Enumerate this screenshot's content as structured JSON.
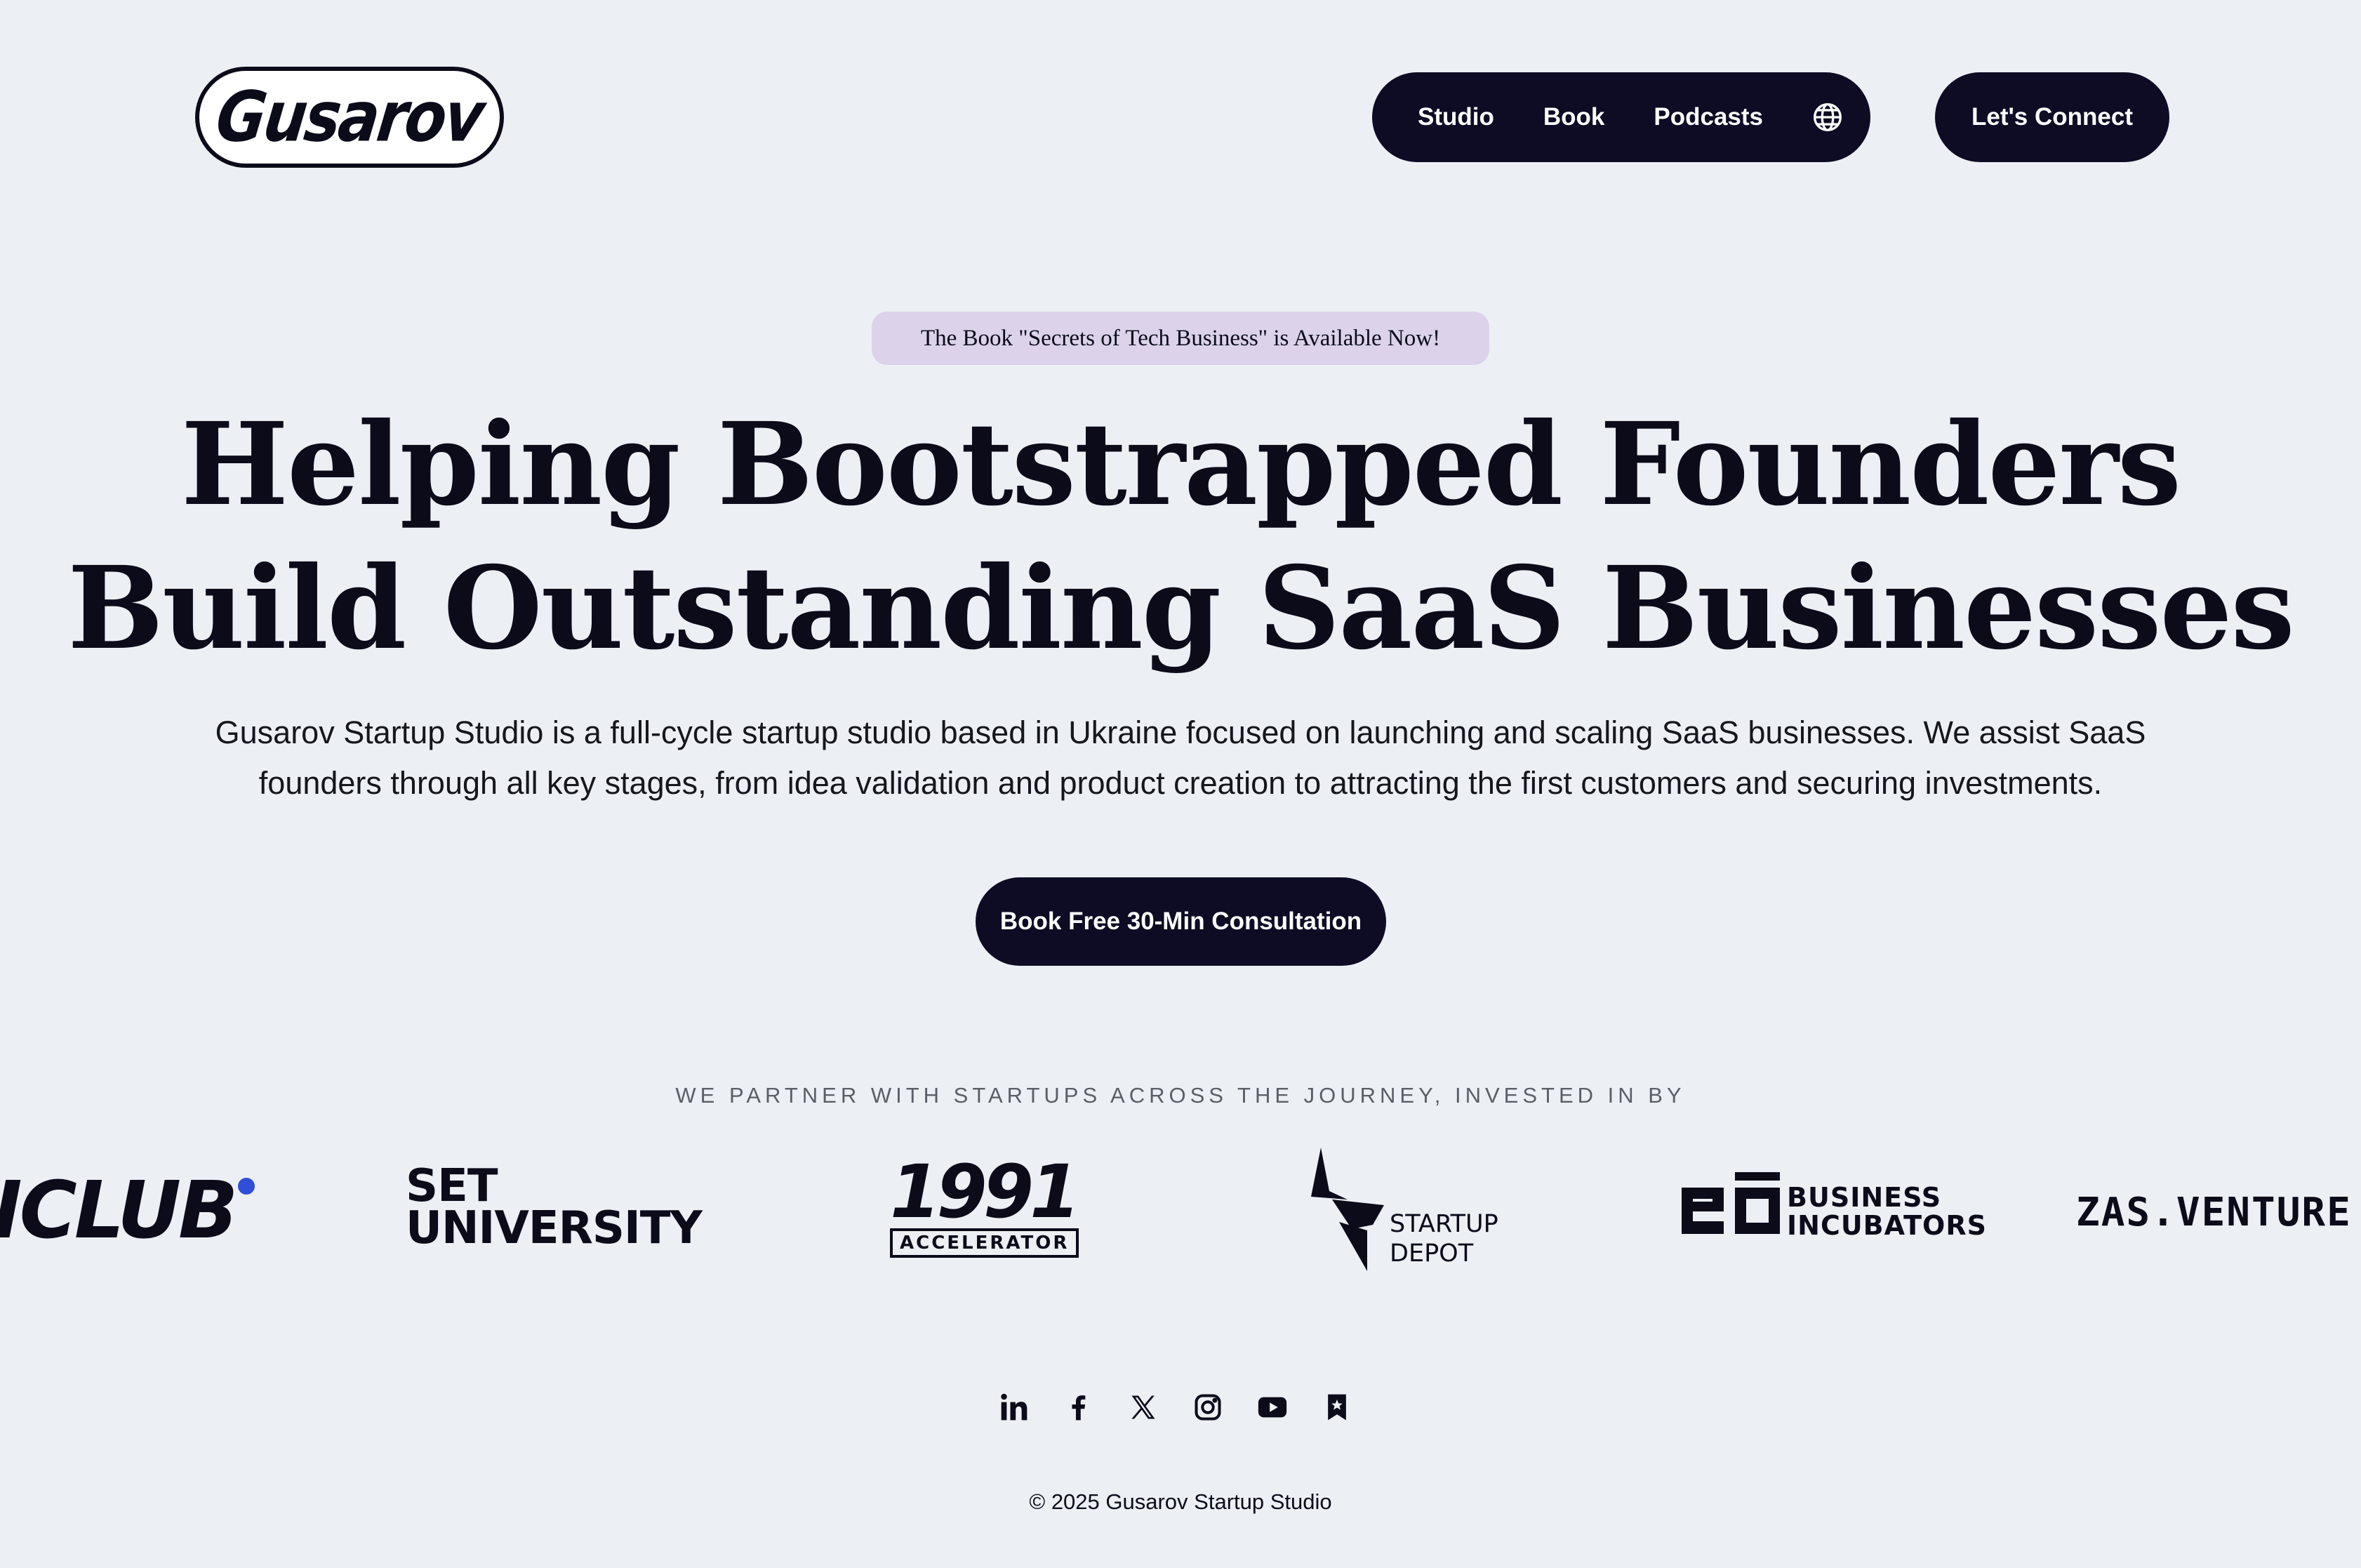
{
  "header": {
    "logo_text": "Gusarov",
    "nav": [
      {
        "label": "Studio"
      },
      {
        "label": "Book"
      },
      {
        "label": "Podcasts"
      }
    ],
    "language_icon": "globe-icon",
    "connect_label": "Let's Connect"
  },
  "hero": {
    "badge": "The Book \"Secrets of Tech Business\" is Available Now!",
    "headline_line1": "Helping Bootstrapped Founders",
    "headline_line2": "Build Outstanding SaaS Businesses",
    "description": "Gusarov Startup Studio is a full-cycle startup studio based in Ukraine focused on launching and scaling SaaS businesses. We assist SaaS founders through all key stages, from idea validation and product creation to attracting the first customers and securing investments.",
    "cta_label": "Book Free 30-Min Consultation"
  },
  "partners": {
    "label": "WE PARTNER WITH STARTUPS ACROSS THE JOURNEY, INVESTED IN BY",
    "logos": [
      {
        "text": "ICLUB",
        "name": "iclub-logo"
      },
      {
        "line1": "SET",
        "line2": "UNIVERSITY",
        "name": "set-university-logo"
      },
      {
        "line1": "1991",
        "line2": "ACCELERATOR",
        "name": "1991-accelerator-logo"
      },
      {
        "line1": "STARTUP",
        "line2": "DEPOT",
        "name": "startup-depot-logo"
      },
      {
        "line1": "BUSINESS",
        "line2": "INCUBATORS",
        "name": "eo-business-incubators-logo"
      },
      {
        "text": "ZAS.VENTURE",
        "name": "zas-ventures-logo"
      }
    ],
    "accent_colors": {
      "iclub_dot": "#2F4FD8",
      "zas_dot": "#F2C94C"
    }
  },
  "footer": {
    "socials": [
      "linkedin-icon",
      "facebook-icon",
      "x-icon",
      "instagram-icon",
      "youtube-icon",
      "bookmark-star-icon"
    ],
    "copyright": "© 2025 Gusarov Startup Studio"
  },
  "colors": {
    "background": "#ECF0F4",
    "dark": "#0D0C24",
    "badge_bg": "#DCD3EA"
  }
}
